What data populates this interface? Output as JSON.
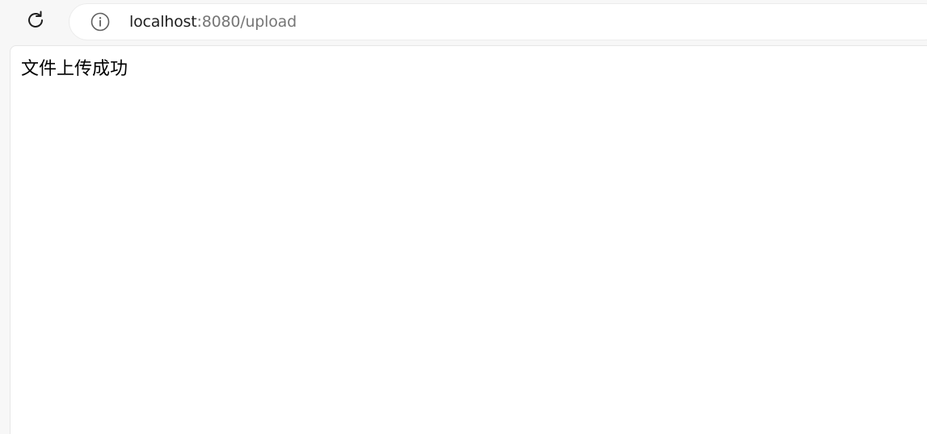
{
  "browser": {
    "url_host": "localhost",
    "url_rest": ":8080/upload",
    "icons": {
      "reload": "reload-icon",
      "site_info": "info-icon"
    }
  },
  "page": {
    "message": "文件上传成功"
  }
}
